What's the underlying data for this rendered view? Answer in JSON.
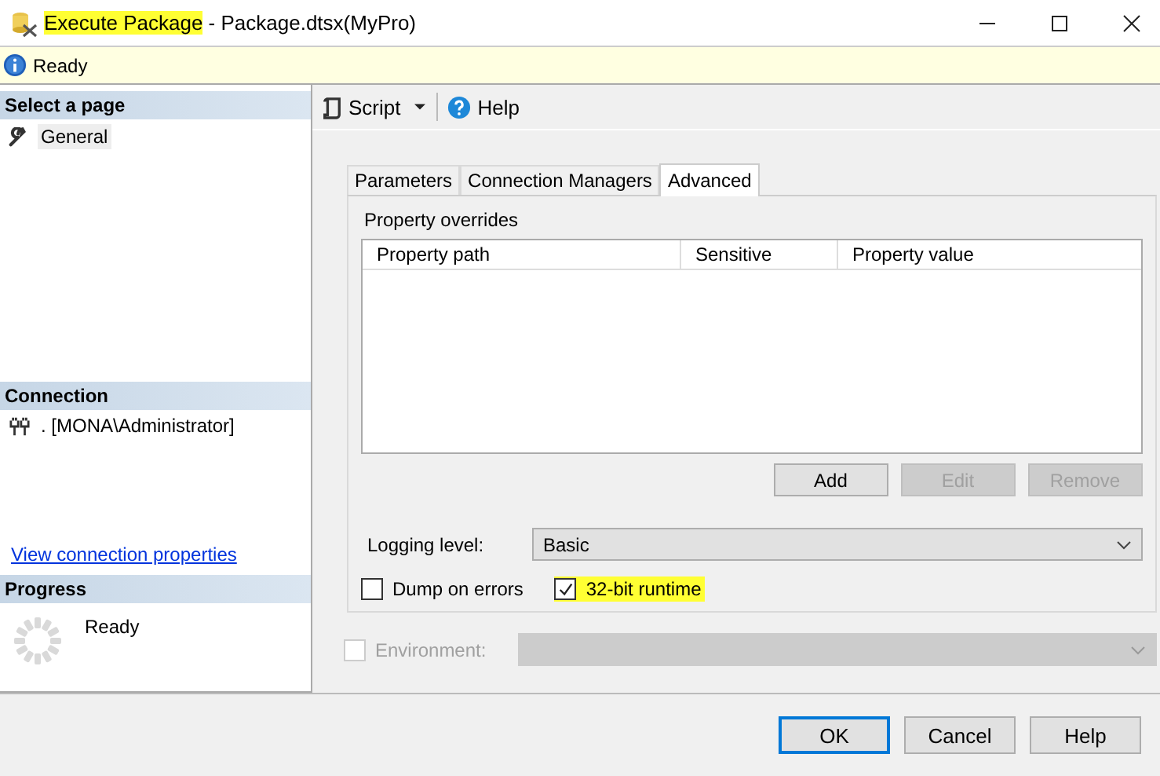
{
  "window": {
    "title_parts": [
      {
        "text": "Execute Package",
        "highlighted": true
      },
      {
        "text": " - Package.dtsx(MyPro)",
        "highlighted": false
      }
    ]
  },
  "info_bar": {
    "message": "Ready"
  },
  "sidebar": {
    "select_page": {
      "heading": "Select a page",
      "items": [
        {
          "label": "General",
          "selected": true
        }
      ]
    },
    "connection": {
      "heading": "Connection",
      "server": ". [MONA\\Administrator]",
      "link": "View connection properties"
    },
    "progress": {
      "heading": "Progress",
      "status": "Ready"
    }
  },
  "toolbar": {
    "items": [
      {
        "kind": "script",
        "label": "Script"
      },
      {
        "kind": "help",
        "label": "Help"
      }
    ]
  },
  "tabs": [
    {
      "label": "Parameters",
      "selected": false
    },
    {
      "label": "Connection Managers",
      "selected": false
    },
    {
      "label": "Advanced",
      "selected": true
    }
  ],
  "property_overrides": {
    "title": "Property overrides",
    "columns": [
      "Property path",
      "Sensitive",
      "Property value"
    ],
    "buttons": [
      {
        "label": "Add",
        "disabled": false
      },
      {
        "label": "Edit",
        "disabled": true
      },
      {
        "label": "Remove",
        "disabled": true
      }
    ]
  },
  "logging_level": {
    "label": "Logging level:",
    "value": "Basic"
  },
  "checkboxes": [
    {
      "label": "Dump on errors",
      "checked": false,
      "highlighted": false
    },
    {
      "label": "32-bit runtime",
      "checked": true,
      "highlighted": true
    }
  ],
  "environment": {
    "label": "Environment:",
    "checked": false,
    "disabled": true
  },
  "buttons": [
    {
      "label": "OK",
      "default": true
    },
    {
      "label": "Cancel",
      "default": false
    },
    {
      "label": "Help",
      "default": false
    }
  ]
}
